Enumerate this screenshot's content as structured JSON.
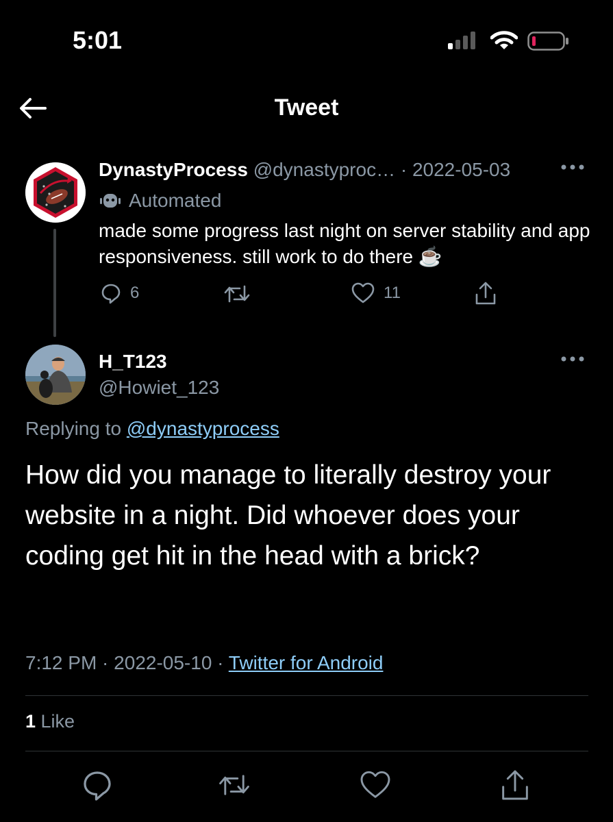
{
  "status_bar": {
    "time": "5:01"
  },
  "header": {
    "title": "Tweet"
  },
  "parent_tweet": {
    "display_name": "DynastyProcess",
    "handle": "@dynastyproc…",
    "separator": " · ",
    "date": "2022-05-03",
    "automated_label": "Automated",
    "text": "made some progress last night on server stability and app responsiveness. still work to do there ☕",
    "reply_count": "6",
    "like_count": "11",
    "icons": {
      "reply": "reply-icon",
      "retweet": "retweet-icon",
      "like": "heart-icon",
      "share": "share-icon",
      "more": "more-icon",
      "bot": "robot-icon"
    }
  },
  "main_tweet": {
    "display_name": "H_T123",
    "handle": "@Howiet_123",
    "replying_prefix": "Replying to ",
    "replying_handle": "@dynastyprocess",
    "text": "How did you manage to literally destroy your website in a night. Did whoever does your coding get hit in the head with a brick?",
    "time": "7:12 PM",
    "sep1": " · ",
    "date": "2022-05-10",
    "sep2": " · ",
    "source": "Twitter for Android",
    "like_count": "1",
    "like_label": " Like"
  },
  "colors": {
    "background": "#000000",
    "text": "#e7e9ea",
    "muted": "#8b98a5",
    "link": "#8ecdf8",
    "divider": "#2f3336",
    "battery_low": "#e0245e"
  }
}
